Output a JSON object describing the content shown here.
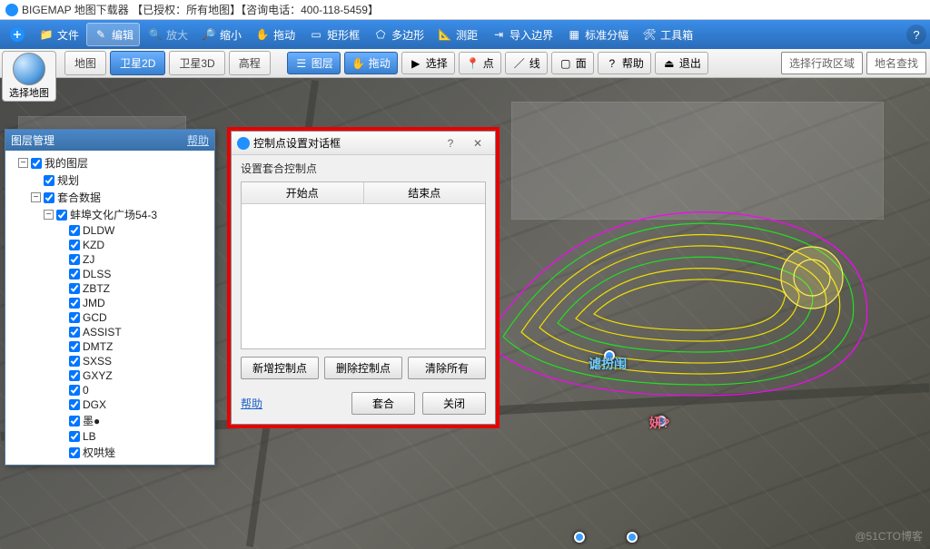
{
  "title": "BIGEMAP 地图下载器 【已授权：所有地图】【咨询电话：400-118-5459】",
  "toolbar_main": {
    "file": "文件",
    "edit": "编辑",
    "zoom_in": "放大",
    "zoom_out": "缩小",
    "pan": "拖动",
    "rect": "矩形框",
    "polygon": "多边形",
    "measure": "测距",
    "import_boundary": "导入边界",
    "standard_sheet": "标准分幅",
    "toolbox": "工具箱"
  },
  "select_map": "选择地图",
  "tabs": {
    "map": "地图",
    "sat2d": "卫星2D",
    "sat3d": "卫星3D",
    "elevation": "高程"
  },
  "toolbar_sec": {
    "layer": "图层",
    "drag": "拖动",
    "select": "选择",
    "point": "点",
    "line": "线",
    "face": "面",
    "help": "帮助",
    "exit": "退出",
    "region_select": "选择行政区域",
    "place_search": "地名查找"
  },
  "layer_panel": {
    "title": "图层管理",
    "help": "帮助",
    "root": "我的图层",
    "items": [
      "规划",
      "套合数据"
    ],
    "sub": "蚌埠文化广场54-3",
    "leaves": [
      "DLDW",
      "KZD",
      "ZJ",
      "DLSS",
      "ZBTZ",
      "JMD",
      "GCD",
      "ASSIST",
      "DMTZ",
      "SXSS",
      "GXYZ",
      "0",
      "DGX",
      "墨●",
      "LB",
      "权哄矬"
    ]
  },
  "dialog": {
    "title": "控制点设置对话框",
    "subtitle": "设置套合控制点",
    "col_start": "开始点",
    "col_end": "结束点",
    "btn_add": "新增控制点",
    "btn_del": "删除控制点",
    "btn_clear": "清除所有",
    "link_help": "帮助",
    "btn_fit": "套合",
    "btn_close": "关闭"
  },
  "map_labels": {
    "l1": "谑扮闱",
    "l2": "妍?"
  },
  "watermark": "@51CTO博客"
}
